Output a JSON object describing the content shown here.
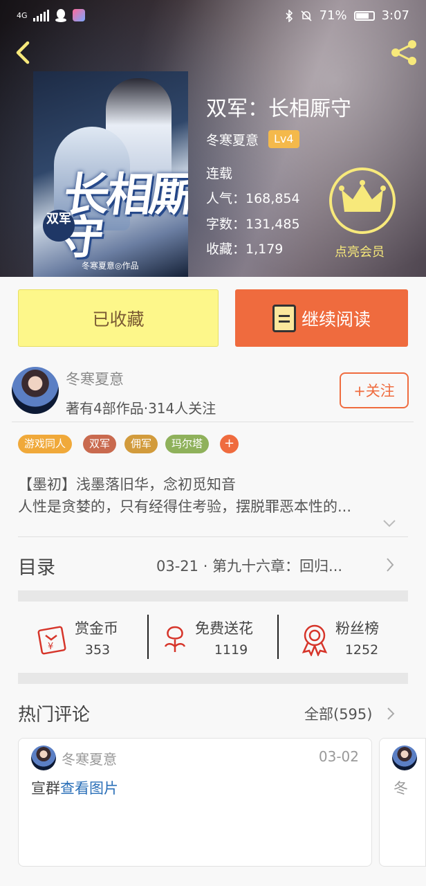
{
  "status_bar": {
    "network": "4G",
    "battery": "71%",
    "time": "3:07"
  },
  "book": {
    "title": "双军：长相厮守",
    "author": "冬寒夏意",
    "level": "Lv4",
    "status": "连载",
    "popularity": "人气：168,854",
    "word_count": "字数：131,485",
    "favorites": "收藏：1,179",
    "member_label": "点亮会员",
    "cover": {
      "title_main": "长相厮守",
      "title_badge": "双军",
      "credit": "冬寒夏意◎作品"
    }
  },
  "actions": {
    "collected_label": "已收藏",
    "read_label": "继续阅读"
  },
  "author_row": {
    "name": "冬寒夏意",
    "meta": "著有4部作品·314人关注",
    "follow_label": "+关注"
  },
  "tags": [
    {
      "label": "游戏同人",
      "color": "#f0a93a"
    },
    {
      "label": "双军",
      "color": "#c96a4f"
    },
    {
      "label": "佣军",
      "color": "#d29b3c"
    },
    {
      "label": "玛尔塔",
      "color": "#8fb15b"
    }
  ],
  "tag_add": "+",
  "intro": {
    "line1": "【墨初】浅墨落旧华，念初觅知音",
    "line2": "人性是贪婪的，只有经得住考验，摆脱罪恶本性的..."
  },
  "toc": {
    "label": "目录",
    "latest": "03-21 · 第九十六章：回归..."
  },
  "rewards": [
    {
      "label": "赏金币",
      "value": "353",
      "icon": "red-envelope-icon"
    },
    {
      "label": "免费送花",
      "value": "1119",
      "icon": "flower-icon"
    },
    {
      "label": "粉丝榜",
      "value": "1252",
      "icon": "medal-icon"
    }
  ],
  "comments": {
    "title": "热门评论",
    "all_label": "全部(595)",
    "items": [
      {
        "user": "冬寒夏意",
        "date": "03-02",
        "text": "宣群",
        "link": "查看图片"
      },
      {
        "user": "冬",
        "date": "",
        "text": "",
        "link": ""
      }
    ]
  },
  "colors": {
    "accent_orange": "#ef6b3e",
    "collected_yellow": "#fdf78a",
    "member_gold": "#f7e97b",
    "link_blue": "#2a6fb8"
  }
}
